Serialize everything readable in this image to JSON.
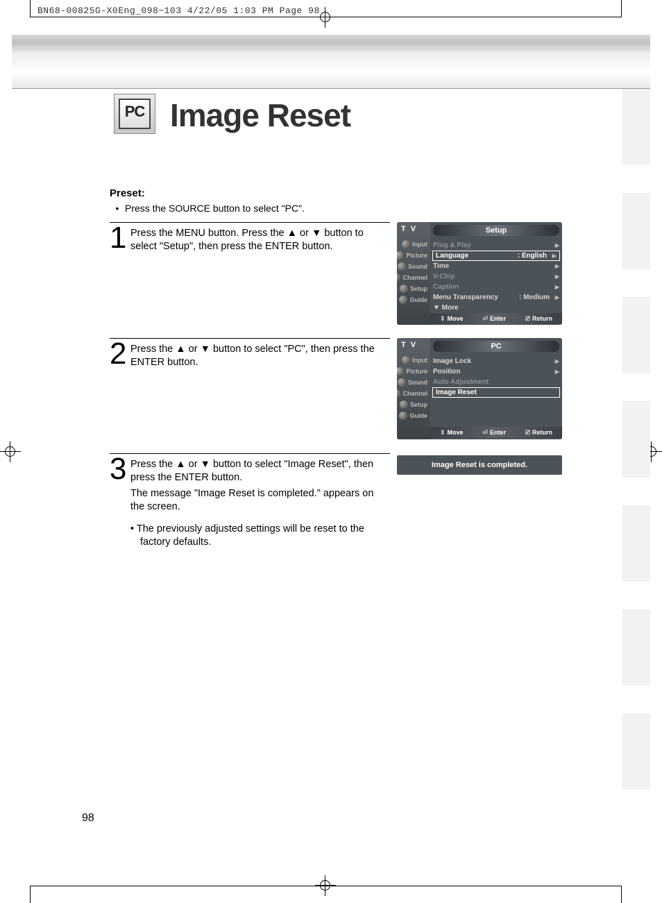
{
  "print_header": "BN68-00825G-X0Eng_098~103  4/22/05  1:03 PM  Page 98",
  "icon_label": "PC",
  "title": "Image Reset",
  "preset": {
    "label": "Preset:",
    "bullet": "Press the SOURCE button to select \"PC\"."
  },
  "steps": [
    {
      "num": "1",
      "text": "Press the MENU button. Press the ▲ or ▼ button to select \"Setup\", then press the ENTER button."
    },
    {
      "num": "2",
      "text": "Press the ▲ or ▼ button to select \"PC\", then press the ENTER button."
    },
    {
      "num": "3",
      "text1": "Press the ▲ or ▼ button to select \"Image Reset\", then press the ENTER button.",
      "text2": "The message \"Image Reset is completed.\" appears on the screen.",
      "bullet": "The previously adjusted settings will be reset to the factory defaults."
    }
  ],
  "osd1": {
    "tv": "T V",
    "title": "Setup",
    "side": [
      "Input",
      "Picture",
      "Sound",
      "Channel",
      "Setup",
      "Guide"
    ],
    "rows": [
      {
        "label": "Plug & Play",
        "muted": true
      },
      {
        "label": "Language",
        "val": ": English",
        "sel": true
      },
      {
        "label": "Time"
      },
      {
        "label": "V-Chip",
        "muted": true
      },
      {
        "label": "Caption",
        "muted": true
      },
      {
        "label": "Menu Transparency",
        "val": ": Medium"
      },
      {
        "label": "▼ More"
      }
    ],
    "footer": {
      "move": "Move",
      "enter": "Enter",
      "return": "Return"
    }
  },
  "osd2": {
    "tv": "T V",
    "title": "PC",
    "side": [
      "Input",
      "Picture",
      "Sound",
      "Channel",
      "Setup",
      "Guide"
    ],
    "rows": [
      {
        "label": "Image Lock"
      },
      {
        "label": "Position"
      },
      {
        "label": "Auto Adjustment",
        "muted": true
      },
      {
        "label": "Image Reset",
        "sel": true,
        "noarrow": true
      }
    ],
    "footer": {
      "move": "Move",
      "enter": "Enter",
      "return": "Return"
    }
  },
  "message_box": "Image Reset is completed.",
  "page_number": "98"
}
